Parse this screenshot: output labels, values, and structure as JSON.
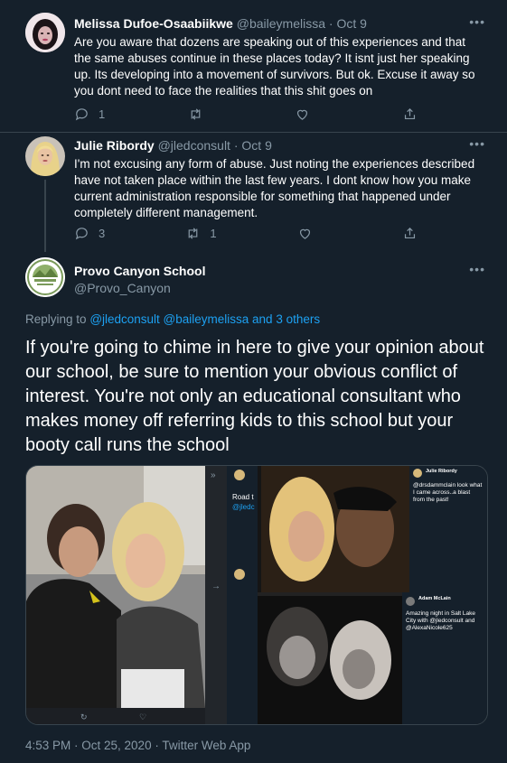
{
  "tweets": [
    {
      "name": "Melissa Dufoe-Osaabiikwe",
      "handle": "@baileymelissa",
      "date": "Oct 9",
      "text": "Are you aware that dozens are speaking out of this experiences and that the same abuses continue in these places today? It isnt just her speaking up. Its developing into a movement of survivors. But ok. Excuse it away so you dont need to face the realities that this shit goes on",
      "replies": "1",
      "retweets": "",
      "likes": ""
    },
    {
      "name": "Julie Ribordy",
      "handle": "@jledconsult",
      "date": "Oct 9",
      "text": "I'm not excusing any form of abuse. Just noting the experiences described have not taken place within the last few years. I dont know how you make current administration responsible for something that happened under completely different management.",
      "replies": "3",
      "retweets": "1",
      "likes": ""
    }
  ],
  "main_tweet": {
    "name": "Provo Canyon School",
    "handle": "@Provo_Canyon",
    "replying_label": "Replying to",
    "replying_to": "@jledconsult @baileymelissa and 3 others",
    "text": "If you're going to chime in here to give your opinion about our school, be sure to mention your obvious conflict of interest. You're not only an educational consultant who makes money off referring kids to this school but your booty call runs the school",
    "timestamp": "4:53 PM · Oct 25, 2020 · Twitter Web App"
  },
  "media": {
    "embedded_tweet_1": {
      "name": "Julie Ribordy",
      "text": "@drsdammclain look what I came across..a blast from the past!"
    },
    "embedded_tweet_2": {
      "name": "Adam McLain",
      "text": "Amazing night in Salt Lake City with @jledconsult and @AlexaNicole625"
    },
    "side_snippet": {
      "line1": "Road t",
      "line2": "@jledc"
    }
  },
  "colors": {
    "background": "#15202b",
    "text": "#ffffff",
    "muted": "#8899a6",
    "accent": "#1da1f2",
    "border": "#38444d"
  }
}
